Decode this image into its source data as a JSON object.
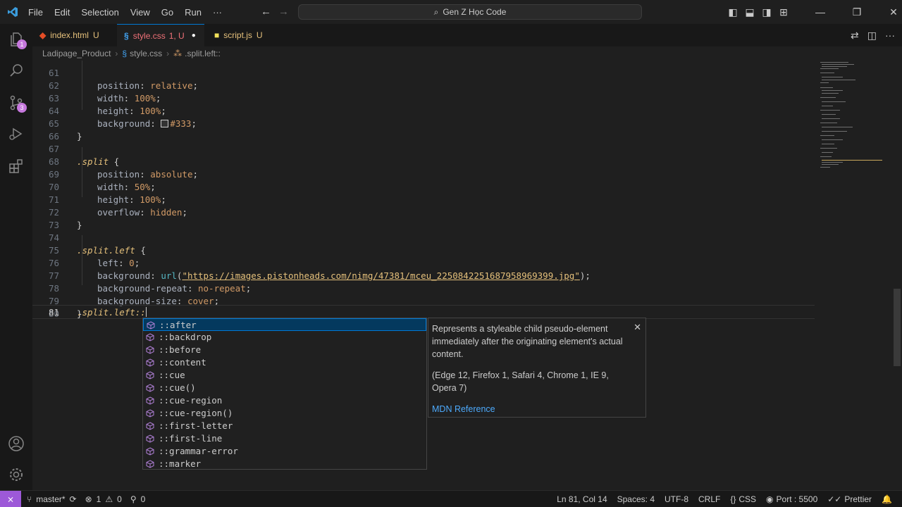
{
  "menu": [
    "File",
    "Edit",
    "Selection",
    "View",
    "Go",
    "Run",
    "···"
  ],
  "search": {
    "label": "Gen Z Học Code"
  },
  "tabs": [
    {
      "name": "index.html",
      "status": "U",
      "icon": "html-icon",
      "color": "#e44d26"
    },
    {
      "name": "style.css",
      "status": "1, U",
      "icon": "css-icon",
      "color": "#f07178"
    },
    {
      "name": "script.js",
      "status": "U",
      "icon": "js-icon",
      "color": "#f1e05a"
    }
  ],
  "breadcrumb": {
    "folder": "Ladipage_Product",
    "file": "style.css",
    "symbol": ".split.left::"
  },
  "activity": {
    "explorer_badge": "1",
    "scm_badge": "3"
  },
  "code": {
    "l61": "61",
    "l61_prop": "position",
    "l61_val": "relative",
    "l62": "62",
    "l62_prop": "width",
    "l62_val": "100%",
    "l63": "63",
    "l63_prop": "height",
    "l63_val": "100%",
    "l64": "64",
    "l64_prop": "background",
    "l64_val": "#333",
    "l65": "65",
    "l66": "66",
    "l67": "67",
    "l67_sel": ".split",
    "l68": "68",
    "l68_prop": "position",
    "l68_val": "absolute",
    "l69": "69",
    "l69_prop": "width",
    "l69_val": "50%",
    "l70": "70",
    "l70_prop": "height",
    "l70_val": "100%",
    "l71": "71",
    "l71_prop": "overflow",
    "l71_val": "hidden",
    "l72": "72",
    "l73": "73",
    "l74": "74",
    "l74_sel": ".split.left",
    "l75": "75",
    "l75_prop": "left",
    "l75_val": "0",
    "l76": "76",
    "l76_prop": "background",
    "l76_fn": "url",
    "l76_str": "\"https://images.pistonheads.com/nimg/47381/mceu_2250842251687958969399.jpg\"",
    "l77": "77",
    "l77_prop": "background-repeat",
    "l77_val": "no-repeat",
    "l78": "78",
    "l78_prop": "background-size",
    "l78_val": "cover",
    "l79": "79",
    "l80": "80",
    "l81": "81",
    "l81_sel": ".split.left::"
  },
  "suggestions": [
    "::after",
    "::backdrop",
    "::before",
    "::content",
    "::cue",
    "::cue()",
    "::cue-region",
    "::cue-region()",
    "::first-letter",
    "::first-line",
    "::grammar-error",
    "::marker"
  ],
  "details": {
    "description": "Represents a styleable child pseudo-element immediately after the originating element's actual content.",
    "compat": "(Edge 12, Firefox 1, Safari 4, Chrome 1, IE 9, Opera 7)",
    "link": "MDN Reference"
  },
  "status": {
    "branch": "master*",
    "errors": "1",
    "warnings": "0",
    "ports": "0",
    "position": "Ln 81, Col 14",
    "spaces": "Spaces: 4",
    "encoding": "UTF-8",
    "eol": "CRLF",
    "language": "CSS",
    "port": "Port : 5500",
    "prettier": "Prettier"
  },
  "colors": {
    "accent": "#0078d4",
    "remote": "#9d59d8",
    "badge": "#c678dd"
  }
}
